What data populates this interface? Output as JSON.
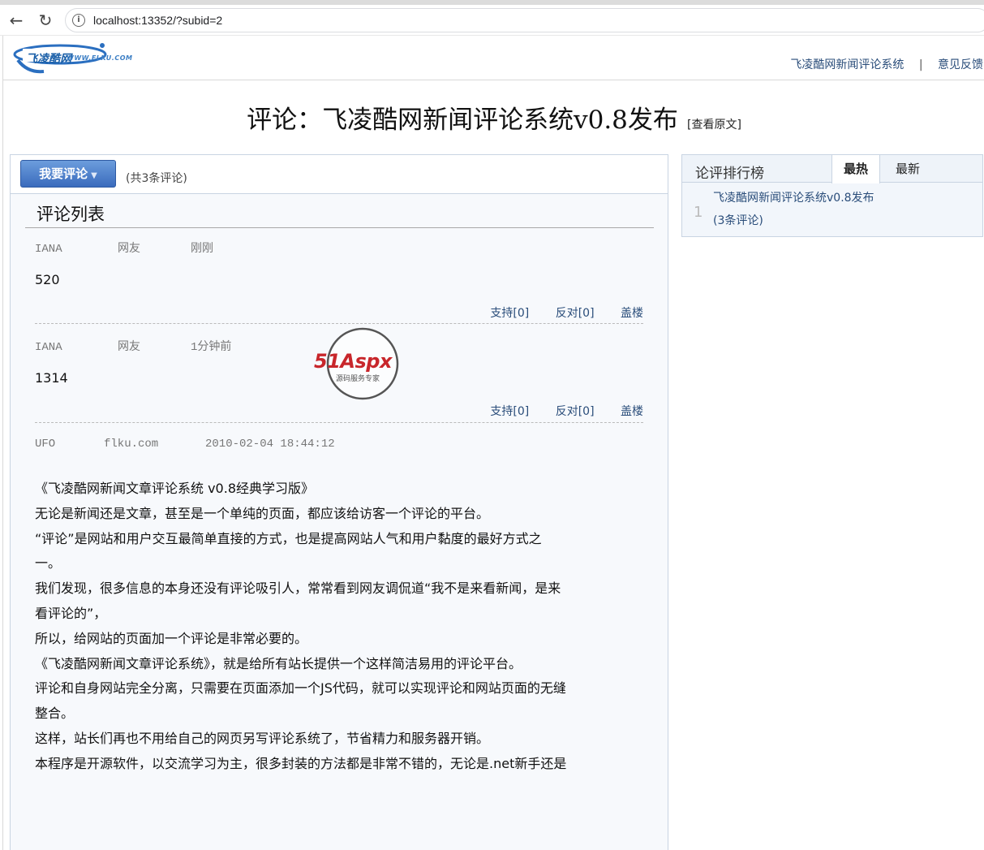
{
  "browser": {
    "url": "localhost:13352/?subid=2"
  },
  "header": {
    "logo_text": "飞凌酷网",
    "logo_sub": "WWW.FLKU.COM",
    "links": [
      "飞凌酷网新闻评论系统",
      "意见反馈"
    ],
    "separator": "|"
  },
  "title": {
    "text": "评论：飞凌酷网新闻评论系统v0.8发布",
    "view_original": "[查看原文]"
  },
  "toolbar": {
    "comment_button": "我要评论",
    "count_text": "(共3条评论)"
  },
  "list": {
    "title": "评论列表",
    "comments": [
      {
        "user": "IANA",
        "from": "网友",
        "time": "刚刚",
        "content": "520",
        "support": "支持[0]",
        "oppose": "反对[0]",
        "reply": "盖楼"
      },
      {
        "user": "IANA",
        "from": "网友",
        "time": "1分钟前",
        "content": "1314",
        "support": "支持[0]",
        "oppose": "反对[0]",
        "reply": "盖楼"
      },
      {
        "user": "UFO",
        "from": "flku.com",
        "time": "2010-02-04 18:44:12"
      }
    ],
    "long_content": [
      "《飞凌酷网新闻文章评论系统 v0.8经典学习版》",
      "",
      "无论是新闻还是文章，甚至是一个单纯的页面，都应该给访客一个评论的平台。",
      "“评论”是网站和用户交互最简单直接的方式，也是提高网站人气和用户黏度的最好方式之",
      "一。",
      "",
      "我们发现，很多信息的本身还没有评论吸引人，常常看到网友调侃道“我不是来看新闻，是来",
      "看评论的”，",
      "所以，给网站的页面加一个评论是非常必要的。",
      "",
      "《飞凌酷网新闻文章评论系统》，就是给所有站长提供一个这样简洁易用的评论平台。",
      "评论和自身网站完全分离，只需要在页面添加一个JS代码，就可以实现评论和网站页面的无缝",
      "整合。",
      "这样，站长们再也不用给自己的网页另写评论系统了，节省精力和服务器开销。",
      "",
      "本程序是开源软件，以交流学习为主，很多封装的方法都是非常不错的，无论是.net新手还是"
    ]
  },
  "watermark": {
    "brand": "51Aspx",
    "sub": "源码服务专家"
  },
  "ranking": {
    "title": "论评排行榜",
    "tabs": [
      "最热",
      "最新"
    ],
    "items": [
      {
        "rank": "1",
        "title": "飞凌酷网新闻评论系统v0.8发布",
        "count": "(3条评论)"
      }
    ]
  },
  "colors": {
    "accent": "#3a6bbd",
    "link": "#2a4d7a",
    "border": "#c9d4e2"
  }
}
